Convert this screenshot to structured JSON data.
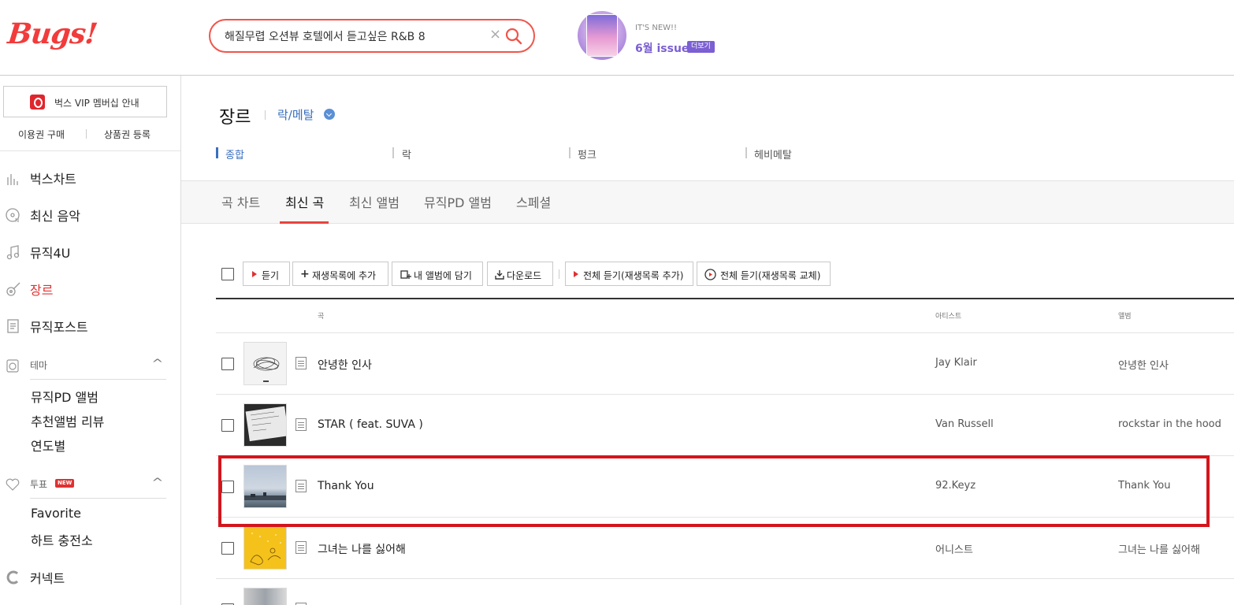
{
  "header": {
    "logo": "Bugs!",
    "search": {
      "value": "해질무렵 오션뷰 호텔에서 듣고싶은 R&B 8",
      "placeholder": ""
    },
    "promo": {
      "small": "IT'S NEW!!",
      "title": "6월 issue",
      "more": "더보기"
    }
  },
  "sidebar": {
    "vip": "벅스 VIP 멤버십 안내",
    "links": [
      "이용권 구매",
      "상품권 등록"
    ],
    "nav": [
      {
        "label": "벅스차트",
        "icon": "chart-icon"
      },
      {
        "label": "최신 음악",
        "icon": "disc-icon"
      },
      {
        "label": "뮤직4U",
        "icon": "music-note-icon"
      },
      {
        "label": "장르",
        "icon": "guitar-icon"
      },
      {
        "label": "뮤직포스트",
        "icon": "post-icon"
      }
    ],
    "theme": {
      "label": "테마",
      "items": [
        "뮤직PD 앨범",
        "추천앨범 리뷰",
        "연도별"
      ]
    },
    "vote": {
      "label": "투표",
      "badge": "NEW",
      "items": [
        "Favorite",
        "하트 충전소"
      ]
    },
    "connect": "커넥트"
  },
  "main": {
    "title": "장르",
    "genre": "락/메탈",
    "subgenres": [
      "종합",
      "락",
      "펑크",
      "헤비메탈"
    ],
    "tabs": [
      "곡 차트",
      "최신 곡",
      "최신 앨범",
      "뮤직PD 앨범",
      "스페셜"
    ],
    "toolbar": {
      "play": "듣기",
      "add_playlist": "재생목록에 추가",
      "my_album": "내 앨범에 담기",
      "download": "다운로드",
      "play_all_add": "전체 듣기(재생목록 추가)",
      "play_all_replace": "전체 듣기(재생목록 교체)"
    },
    "columns": {
      "song": "곡",
      "artist": "아티스트",
      "album": "앨범"
    },
    "rows": [
      {
        "title": "안녕한 인사",
        "artist": "Jay Klair",
        "album": "안녕한 인사"
      },
      {
        "title": "STAR ( feat. SUVA )",
        "artist": "Van Russell",
        "album": "rockstar in the hood"
      },
      {
        "title": "Thank You",
        "artist": "92.Keyz",
        "album": "Thank You"
      },
      {
        "title": "그녀는 나를 싫어해",
        "artist": "어니스트",
        "album": "그녀는 나를 싫어해"
      }
    ]
  },
  "colors": {
    "accent": "#e03131",
    "link": "#3a6fbf",
    "promo": "#7b5fd3",
    "highlight": "#d4151c"
  }
}
